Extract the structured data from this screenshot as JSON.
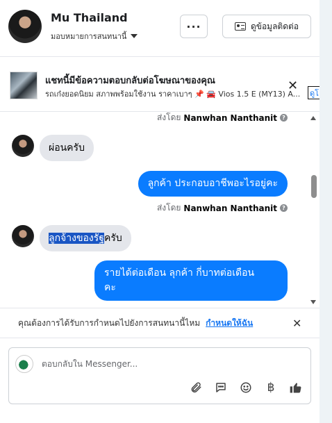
{
  "header": {
    "name": "Mu Thailand",
    "assign_label": "มอบหมายการสนทนานี้",
    "more_label": "···",
    "contact_button_label": "ดูข้อมูลติดต่อ"
  },
  "ad_banner": {
    "title": "แชทนี้มีข้อความตอบกลับต่อโฆษณาของคุณ",
    "subtitle": "รถเก๋งยอดนิยม สภาพพร้อมใช้งาน ราคาเบาๆ 📌 🚘 Vios 1.5 E (MY13) A...",
    "close_label": "✕",
    "edge_text": "ดูโ"
  },
  "messages": [
    {
      "type": "sent_by",
      "prefix": "ส่งโดย",
      "sender": "Nanwhan Nanthanit"
    },
    {
      "type": "incoming",
      "text": "ผ่อนครับ"
    },
    {
      "type": "outgoing",
      "text": "ลูกค้า ประกอบอาชีพอะไรอยู่คะ"
    },
    {
      "type": "sent_by",
      "prefix": "ส่งโดย",
      "sender": "Nanwhan Nanthanit"
    },
    {
      "type": "incoming",
      "highlighted": "ลูกจ้างของรัฐ",
      "rest": "ครับ"
    },
    {
      "type": "outgoing",
      "line1": "รายได้ต่อเดือน  ลุกค้า  กี่บาทต่อเดือน",
      "line2": "คะ"
    }
  ],
  "assign_prompt": {
    "text": "คุณต้องการได้รับการกำหนดไปยังการสนทนานี้ไหม",
    "link": "กำหนดให้ฉัน",
    "close_label": "✕"
  },
  "composer": {
    "placeholder": "ตอบกลับใน Messenger...",
    "tools": [
      "paperclip-icon",
      "speech-bubble-icon",
      "emoji-icon",
      "baht-icon",
      "thumbs-up-icon"
    ],
    "baht_symbol": "฿"
  },
  "colors": {
    "outgoing_bubble": "#0a7cff",
    "incoming_bubble": "#e4e6eb",
    "link": "#1877f2",
    "highlight": "#1a56c4"
  }
}
